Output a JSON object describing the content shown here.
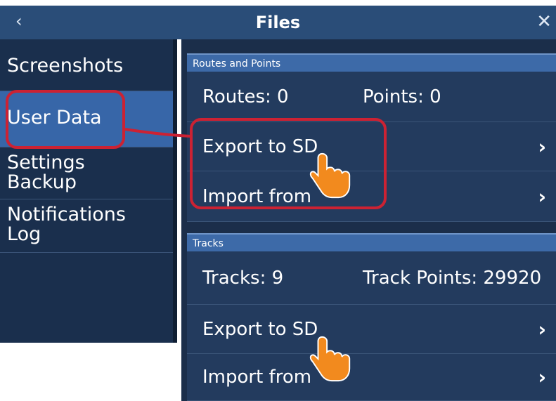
{
  "titlebar": {
    "back_icon": "chevron-left-icon",
    "title": "Files",
    "close_icon": "close-icon"
  },
  "sidebar": {
    "items": [
      {
        "label": "Screenshots",
        "selected": false
      },
      {
        "label": "User Data",
        "selected": true
      },
      {
        "label_line1": "Settings",
        "label_line2": "Backup",
        "selected": false
      },
      {
        "label_line1": "Notifications",
        "label_line2": "Log",
        "selected": false
      }
    ]
  },
  "routes_section": {
    "header": "Routes and Points",
    "routes_label": "Routes: 0",
    "points_label": "Points: 0",
    "export_label": "Export to SD",
    "import_label": "Import from"
  },
  "tracks_section": {
    "header": "Tracks",
    "tracks_label": "Tracks: 9",
    "track_points_label": "Track Points: 29920",
    "export_label": "Export to SD",
    "import_label": "Import from"
  },
  "colors": {
    "titlebar": "#2a4d78",
    "sidebar": "#1a2f4d",
    "selected": "#3766a8",
    "section_header": "#3d6aa8",
    "row": "#233b5e",
    "annotation": "#cc2233",
    "hand": "#f28a1e"
  }
}
